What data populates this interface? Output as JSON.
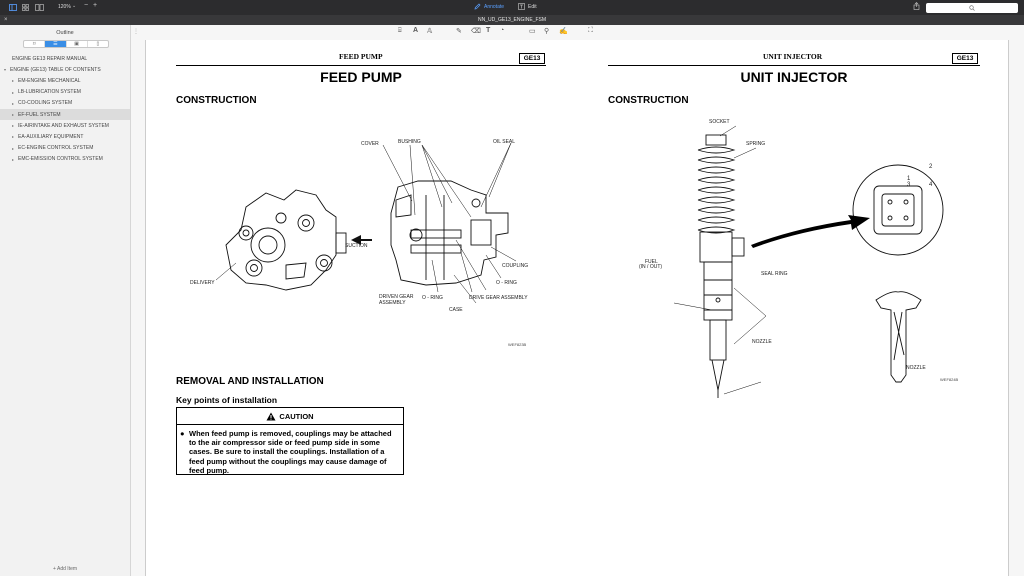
{
  "toolbar": {
    "zoom": "120%",
    "annotate_label": "Annotate",
    "edit_label": "Edit"
  },
  "window": {
    "title": "NN_UD_GE13_ENGINE_FSM"
  },
  "sidebar": {
    "title": "Outline",
    "items": [
      {
        "label": "ENGINE GE13 REPAIR MANUAL"
      },
      {
        "label": "ENGINE (GE13) TABLE OF CONTENTS"
      },
      {
        "label": "EM-ENGINE MECHANICAL"
      },
      {
        "label": "LB-LUBRICATION SYSTEM"
      },
      {
        "label": "CO-COOLING SYSTEM"
      },
      {
        "label": "EF-FUEL SYSTEM"
      },
      {
        "label": "IE-AIRINTAKE AND EXHAUST SYSTEM"
      },
      {
        "label": "EA-AUXILIARY EQUIPMENT"
      },
      {
        "label": "EC-ENGINE CONTROL SYSTEM"
      },
      {
        "label": "EMC-EMISSION CONTROL SYSTEM"
      }
    ],
    "add_item_label": "Add Item"
  },
  "page_left": {
    "header_title": "FEED PUMP",
    "badge": "GE13",
    "title": "FEED PUMP",
    "section1": "CONSTRUCTION",
    "labels": {
      "cover": "COVER",
      "bushing": "BUSHING",
      "oil_seal": "OIL SEAL",
      "suction": "SUCTION",
      "delivery": "DELIVERY",
      "coupling": "COUPLING",
      "o_ring_right": "O - RING",
      "driven_gear": "DRIVEN GEAR\nASSEMBLY",
      "o_ring": "O - RING",
      "drive_gear": "DRIVE GEAR ASSEMBLY",
      "case": "CASE"
    },
    "fig_code": "WEF823B",
    "section2": "REMOVAL AND INSTALLATION",
    "subheading": "Key points of installation",
    "caution_title": "CAUTION",
    "caution_text": "When feed pump is removed, couplings may be attached to the air compressor side or feed pump side in some cases. Be sure to install the couplings. Installation of a feed pump without the couplings may cause damage of feed pump."
  },
  "page_right": {
    "header_title": "UNIT INJECTOR",
    "badge": "GE13",
    "title": "UNIT INJECTOR",
    "section1": "CONSTRUCTION",
    "labels": {
      "socket": "SOCKET",
      "spring": "SPRING",
      "fuel": "FUEL",
      "fuel_io": "(IN / OUT)",
      "seal_ring": "SEAL RING",
      "nozzle": "NOZZLE",
      "nozzle2": "NOZZLE",
      "pin1": "1",
      "pin2": "2",
      "pin3": "3",
      "pin4": "4"
    },
    "fig_code": "WEF824B"
  },
  "colors": {
    "accent": "#3a8ee6",
    "toolbar_bg": "#2c2c2e"
  }
}
